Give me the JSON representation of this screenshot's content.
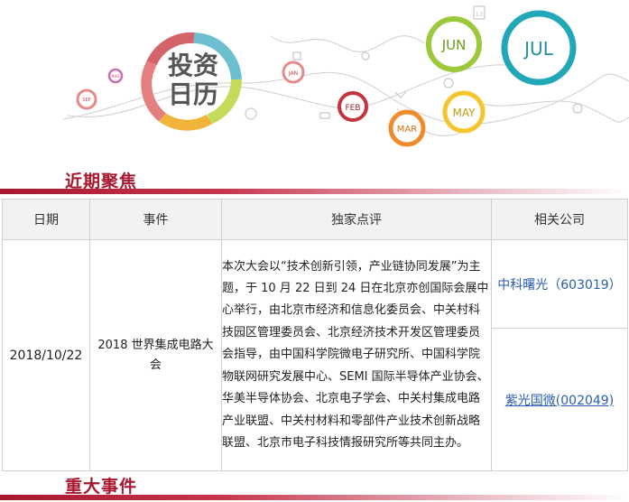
{
  "banner": {
    "logo_line1": "投资",
    "logo_line2": "日历",
    "months": [
      "SEP",
      "AUG",
      "JAN",
      "FEB",
      "MAR",
      "MAY",
      "JUN",
      "JUL"
    ],
    "calendar_badge": "12"
  },
  "sections": {
    "focus_title": "近期聚焦",
    "major_title": "重大事件"
  },
  "table": {
    "headers": [
      "日期",
      "事件",
      "独家点评",
      "相关公司"
    ],
    "row": {
      "date": "2018/10/22",
      "event": "2018 世界集成电路大会",
      "comment": "本次大会以“技术创新引领，产业链协同发展”为主题，于 10 月 22 日到 24 日在北京亦创国际会展中心举行，由北京市经济和信息化委员会、中关村科技园区管理委员会、北京经济技术开发区管理委员会指导，由中国科学院微电子研究所、中国科学院物联网研究发展中心、SEMI 国际半导体产业协会、华美半导体协会、北京电子学会、中关村集成电路产业联盟、中关村材料和零部件产业技术创新战略联盟、北京市电子科技情报研究所等共同主办。",
      "companies": [
        "中科曙光（603019）",
        "紫光国微(002049)"
      ]
    }
  },
  "colors": {
    "accent": "#a8172e",
    "link": "#2a5db0"
  }
}
